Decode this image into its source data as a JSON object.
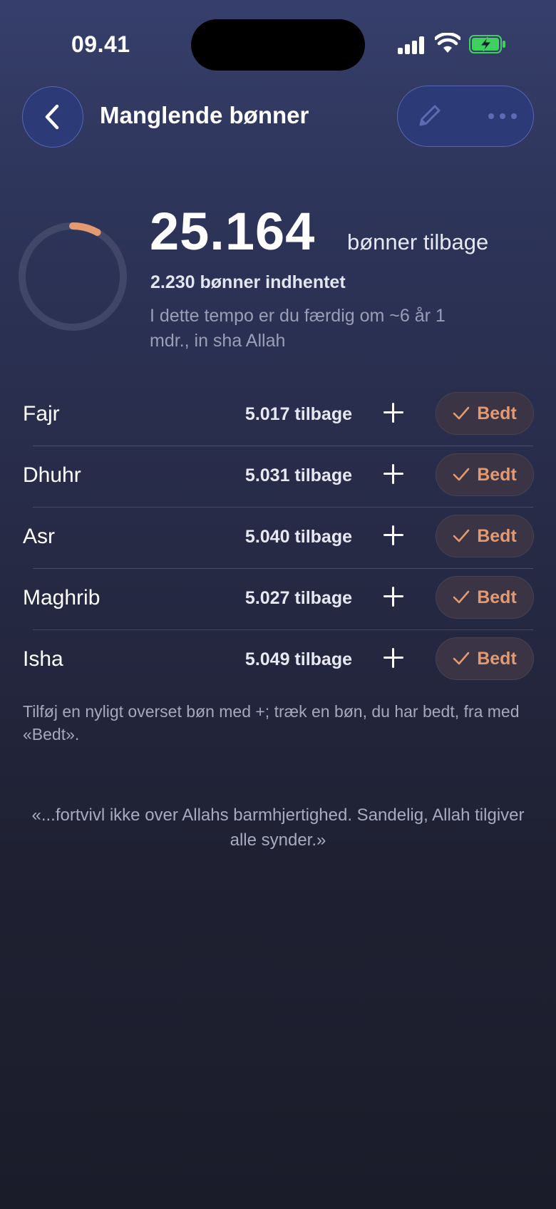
{
  "status_bar": {
    "time": "09.41"
  },
  "header": {
    "title": "Manglende bønner"
  },
  "summary": {
    "remaining_number": "25.164",
    "remaining_suffix": "bønner tilbage",
    "recovered": "2.230 bønner indhentet",
    "pace": "I dette tempo er du færdig om ~6 år 1 mdr., in sha Allah",
    "progress_fraction": 0.081
  },
  "prayers": [
    {
      "name": "Fajr",
      "remaining": "5.017 tilbage",
      "done_label": "Bedt"
    },
    {
      "name": "Dhuhr",
      "remaining": "5.031 tilbage",
      "done_label": "Bedt"
    },
    {
      "name": "Asr",
      "remaining": "5.040 tilbage",
      "done_label": "Bedt"
    },
    {
      "name": "Maghrib",
      "remaining": "5.027 tilbage",
      "done_label": "Bedt"
    },
    {
      "name": "Isha",
      "remaining": "5.049 tilbage",
      "done_label": "Bedt"
    }
  ],
  "hint": "Tilføj en nyligt overset bøn med +; træk en bøn, du har bedt, fra med «Bedt».",
  "quote": "«...fortvivl ikke over Allahs barmhjertighed. Sandelig, Allah tilgiver alle synder.»",
  "colors": {
    "accent": "#e39a70",
    "button_bg": "#2c3a78",
    "bedt_bg": "#3a3444"
  },
  "icons": [
    "back-chevron-icon",
    "pencil-icon",
    "more-dots-icon",
    "plus-icon",
    "checkmark-icon"
  ]
}
